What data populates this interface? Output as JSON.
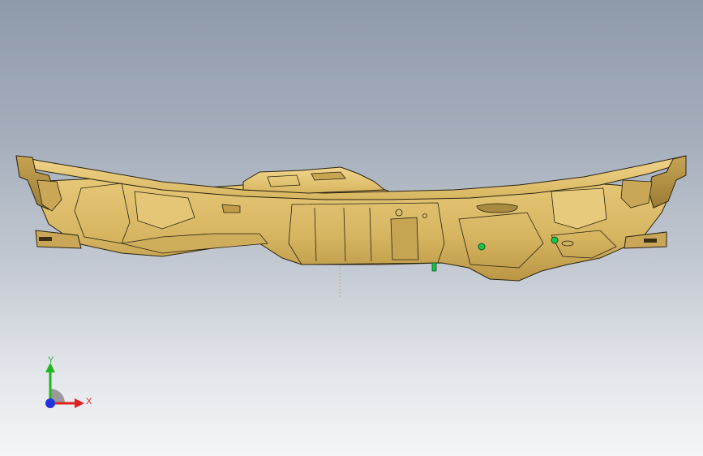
{
  "viewport": {
    "background_top": "#8f9aaa",
    "background_bottom": "#f4f5f7"
  },
  "model": {
    "part_color": "#d9b866",
    "edge_color": "#2a2210",
    "marker_color": "#19c24a"
  },
  "triad": {
    "x_label": "X",
    "y_label": "Y",
    "x_color": "#e02020",
    "y_color": "#22b522",
    "z_color": "#2233dd"
  }
}
